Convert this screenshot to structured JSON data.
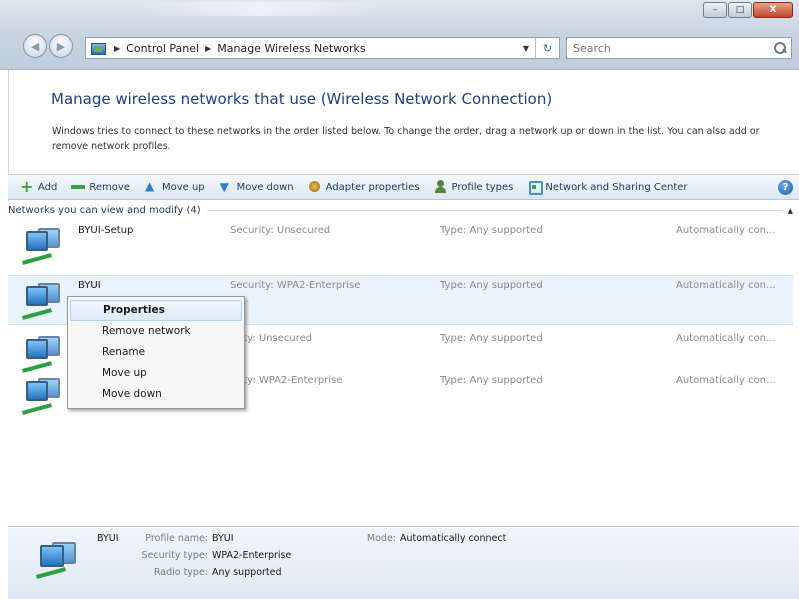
{
  "address_bar": {
    "breadcrumb": [
      "Control Panel",
      "Manage Wireless Networks"
    ],
    "search_placeholder": "Search"
  },
  "window_controls": {
    "minimize": "–",
    "maximize": "□",
    "close": "X"
  },
  "header": {
    "title": "Manage wireless networks that use (Wireless Network Connection)",
    "description": "Windows tries to connect to these networks in the order listed below. To change the order, drag a network up or down in the list. You can also add or remove network profiles."
  },
  "toolbar": {
    "add": "Add",
    "remove": "Remove",
    "move_up": "Move up",
    "move_down": "Move down",
    "adapter_properties": "Adapter properties",
    "profile_types": "Profile types",
    "network_center": "Network and Sharing Center",
    "help": "?"
  },
  "list": {
    "group_header": "Networks you can view and modify (4)",
    "networks": [
      {
        "name": "BYUI-Setup",
        "security": "Security: Unsecured",
        "type": "Type: Any supported",
        "mode": "Automatically con..."
      },
      {
        "name": "BYUI",
        "security": "Security: WPA2-Enterprise",
        "type": "Type: Any supported",
        "mode": "Automatically con..."
      },
      {
        "name": "",
        "security": "urity: Unsecured",
        "type": "Type: Any supported",
        "mode": "Automatically con..."
      },
      {
        "name": "",
        "security": "urity: WPA2-Enterprise",
        "type": "Type: Any supported",
        "mode": "Automatically con..."
      }
    ]
  },
  "context_menu": {
    "items": [
      "Properties",
      "Remove network",
      "Rename",
      "Move up",
      "Move down"
    ]
  },
  "details": {
    "name": "BYUI",
    "profile_name_label": "Profile name:",
    "profile_name": "BYUI",
    "security_type_label": "Security type:",
    "security_type": "WPA2-Enterprise",
    "radio_type_label": "Radio type:",
    "radio_type": "Any supported",
    "mode_label": "Mode:",
    "mode": "Automatically connect"
  }
}
